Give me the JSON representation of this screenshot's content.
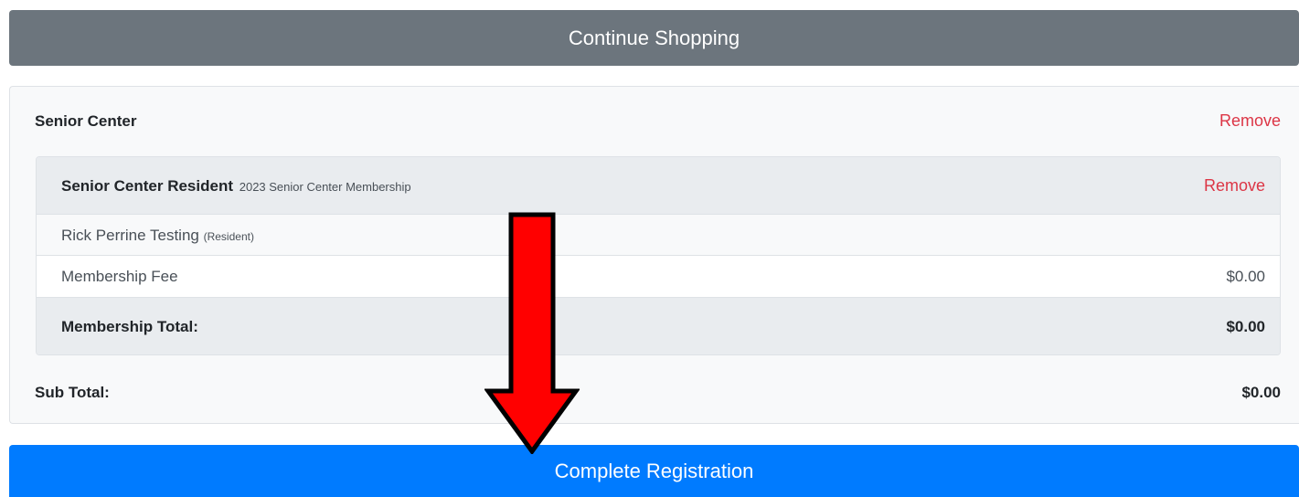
{
  "buttons": {
    "continue_shopping": "Continue Shopping",
    "complete_registration": "Complete Registration"
  },
  "cart": {
    "facility": "Senior Center",
    "remove_label": "Remove",
    "item": {
      "title": "Senior Center Resident",
      "subtitle": "2023 Senior Center Membership",
      "remove_label": "Remove",
      "participant_name": "Rick Perrine Testing",
      "participant_type": "(Resident)",
      "fee_label": "Membership Fee",
      "fee_value": "$0.00",
      "total_label": "Membership Total:",
      "total_value": "$0.00"
    },
    "subtotal_label": "Sub Total:",
    "subtotal_value": "$0.00"
  },
  "colors": {
    "secondary_button": "#6c757d",
    "primary_button": "#007bff",
    "remove_link": "#dc3545",
    "annotation_arrow": "#ff0000"
  },
  "annotation": {
    "icon": "down-arrow-icon"
  }
}
